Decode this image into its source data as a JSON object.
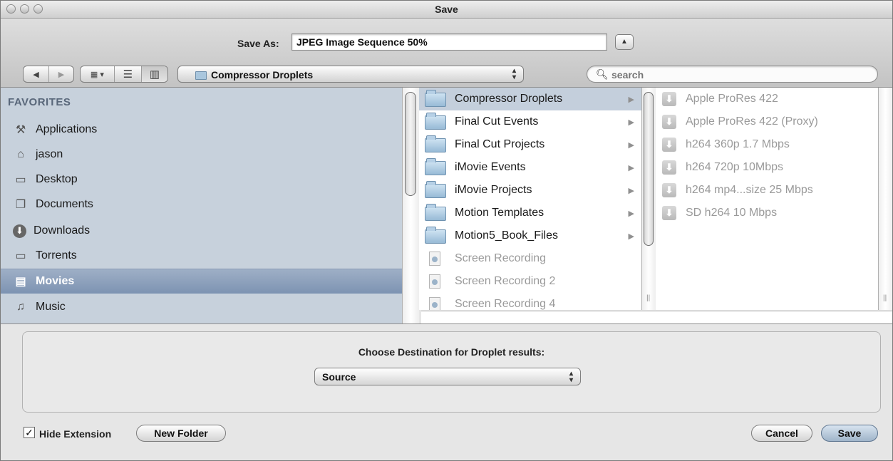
{
  "window": {
    "title": "Save"
  },
  "save_as": {
    "label": "Save As:",
    "value": "JPEG Image Sequence 50%"
  },
  "toolbar": {
    "back_icon": "triangle-left-icon",
    "forward_icon": "triangle-right-icon",
    "view_icons": [
      "icon-view",
      "list-view",
      "column-view"
    ],
    "location": "Compressor Droplets",
    "search_placeholder": "search"
  },
  "sidebar": {
    "section": "FAVORITES",
    "items": [
      {
        "label": "Applications",
        "icon": "applications-icon"
      },
      {
        "label": "jason",
        "icon": "home-icon"
      },
      {
        "label": "Desktop",
        "icon": "desktop-icon"
      },
      {
        "label": "Documents",
        "icon": "documents-icon"
      },
      {
        "label": "Downloads",
        "icon": "downloads-icon"
      },
      {
        "label": "Torrents",
        "icon": "folder-icon"
      },
      {
        "label": "Movies",
        "icon": "movies-icon",
        "selected": true
      },
      {
        "label": "Music",
        "icon": "music-icon"
      }
    ]
  },
  "column1": {
    "items": [
      {
        "label": "Compressor Droplets",
        "type": "folder",
        "selected": true
      },
      {
        "label": "Final Cut Events",
        "type": "folder"
      },
      {
        "label": "Final Cut Projects",
        "type": "folder"
      },
      {
        "label": "iMovie Events",
        "type": "folder"
      },
      {
        "label": "iMovie Projects",
        "type": "folder"
      },
      {
        "label": "Motion Templates",
        "type": "folder"
      },
      {
        "label": "Motion5_Book_Files",
        "type": "folder"
      },
      {
        "label": "Screen Recording",
        "type": "file"
      },
      {
        "label": "Screen Recording 2",
        "type": "file"
      },
      {
        "label": "Screen Recording 4",
        "type": "file"
      }
    ]
  },
  "column2": {
    "items": [
      {
        "label": "Apple ProRes 422"
      },
      {
        "label": "Apple ProRes 422 (Proxy)"
      },
      {
        "label": "h264 360p 1.7 Mbps"
      },
      {
        "label": "h264 720p 10Mbps"
      },
      {
        "label": "h264 mp4...size 25 Mbps"
      },
      {
        "label": "SD h264 10 Mbps"
      }
    ]
  },
  "accessory": {
    "label": "Choose Destination for Droplet results:",
    "destination": "Source"
  },
  "footer": {
    "hide_extension_label": "Hide Extension",
    "hide_extension_checked": true,
    "new_folder_label": "New Folder",
    "cancel_label": "Cancel",
    "save_label": "Save"
  }
}
